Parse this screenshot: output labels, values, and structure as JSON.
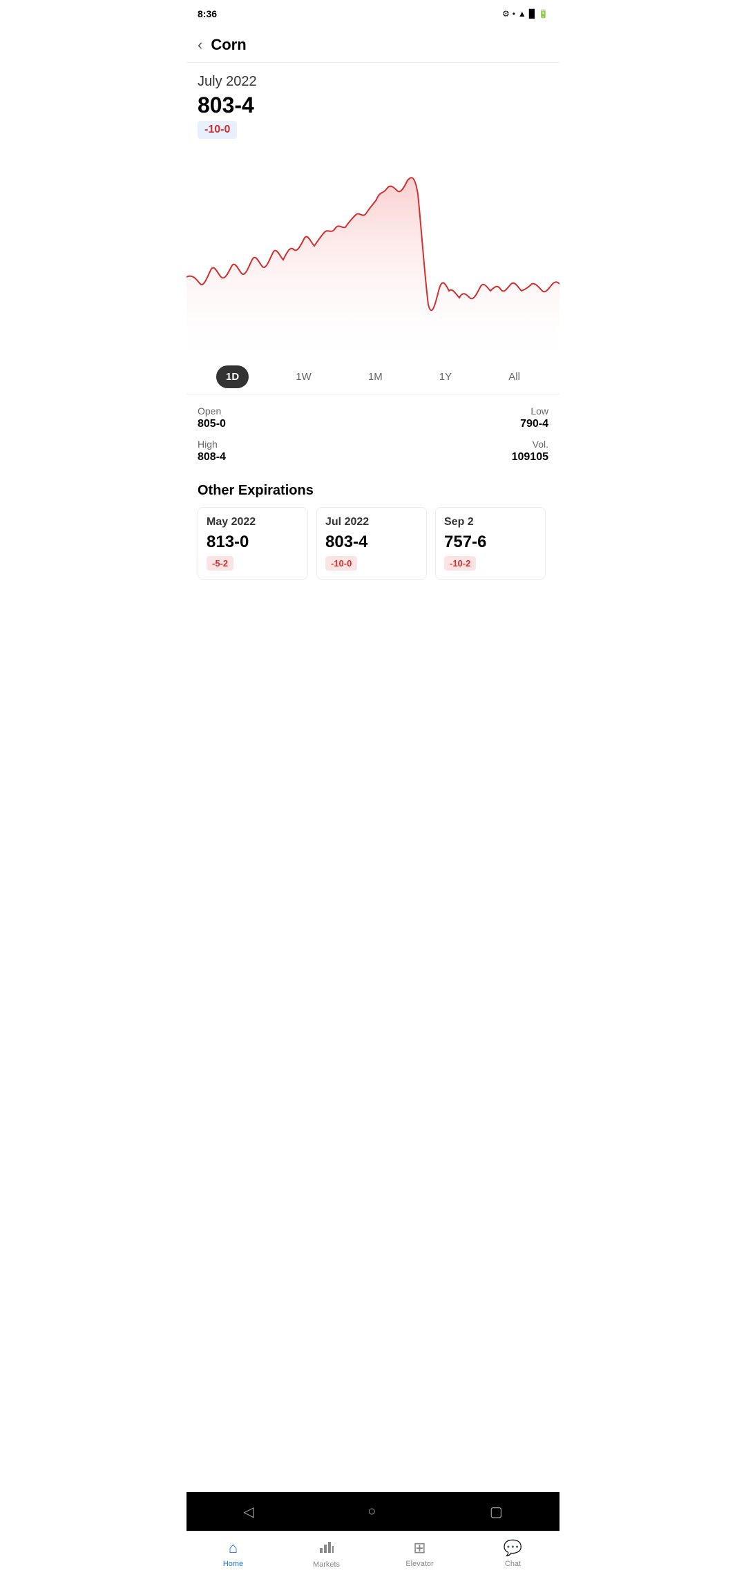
{
  "statusBar": {
    "time": "8:36",
    "icons": [
      "⚙",
      "•",
      "▲",
      "▉",
      "🔋"
    ]
  },
  "header": {
    "backLabel": "‹",
    "title": "Corn"
  },
  "priceSection": {
    "date": "July 2022",
    "price": "803-4",
    "change": "-10-0"
  },
  "timeTabs": [
    {
      "label": "1D",
      "active": true
    },
    {
      "label": "1W",
      "active": false
    },
    {
      "label": "1M",
      "active": false
    },
    {
      "label": "1Y",
      "active": false
    },
    {
      "label": "All",
      "active": false
    }
  ],
  "stats": {
    "open": {
      "label": "Open",
      "value": "805-0"
    },
    "low": {
      "label": "Low",
      "value": "790-4"
    },
    "high": {
      "label": "High",
      "value": "808-4"
    },
    "vol": {
      "label": "Vol.",
      "value": "109105"
    }
  },
  "otherExpirations": {
    "title": "Other Expirations",
    "cards": [
      {
        "date": "May 2022",
        "price": "813-0",
        "change": "-5-2"
      },
      {
        "date": "Jul 2022",
        "price": "803-4",
        "change": "-10-0"
      },
      {
        "date": "Sep 2",
        "price": "757-6",
        "change": "-10-2"
      }
    ]
  },
  "bottomNav": [
    {
      "label": "Home",
      "icon": "⌂",
      "active": true
    },
    {
      "label": "Markets",
      "icon": "📊",
      "active": false
    },
    {
      "label": "Elevator",
      "icon": "⊞",
      "active": false
    },
    {
      "label": "Chat",
      "icon": "💬",
      "active": false
    }
  ],
  "colors": {
    "accent": "#1a73e8",
    "negative": "#d32f2f",
    "negativeBg": "#fce4e4",
    "activeTab": "#333333"
  }
}
